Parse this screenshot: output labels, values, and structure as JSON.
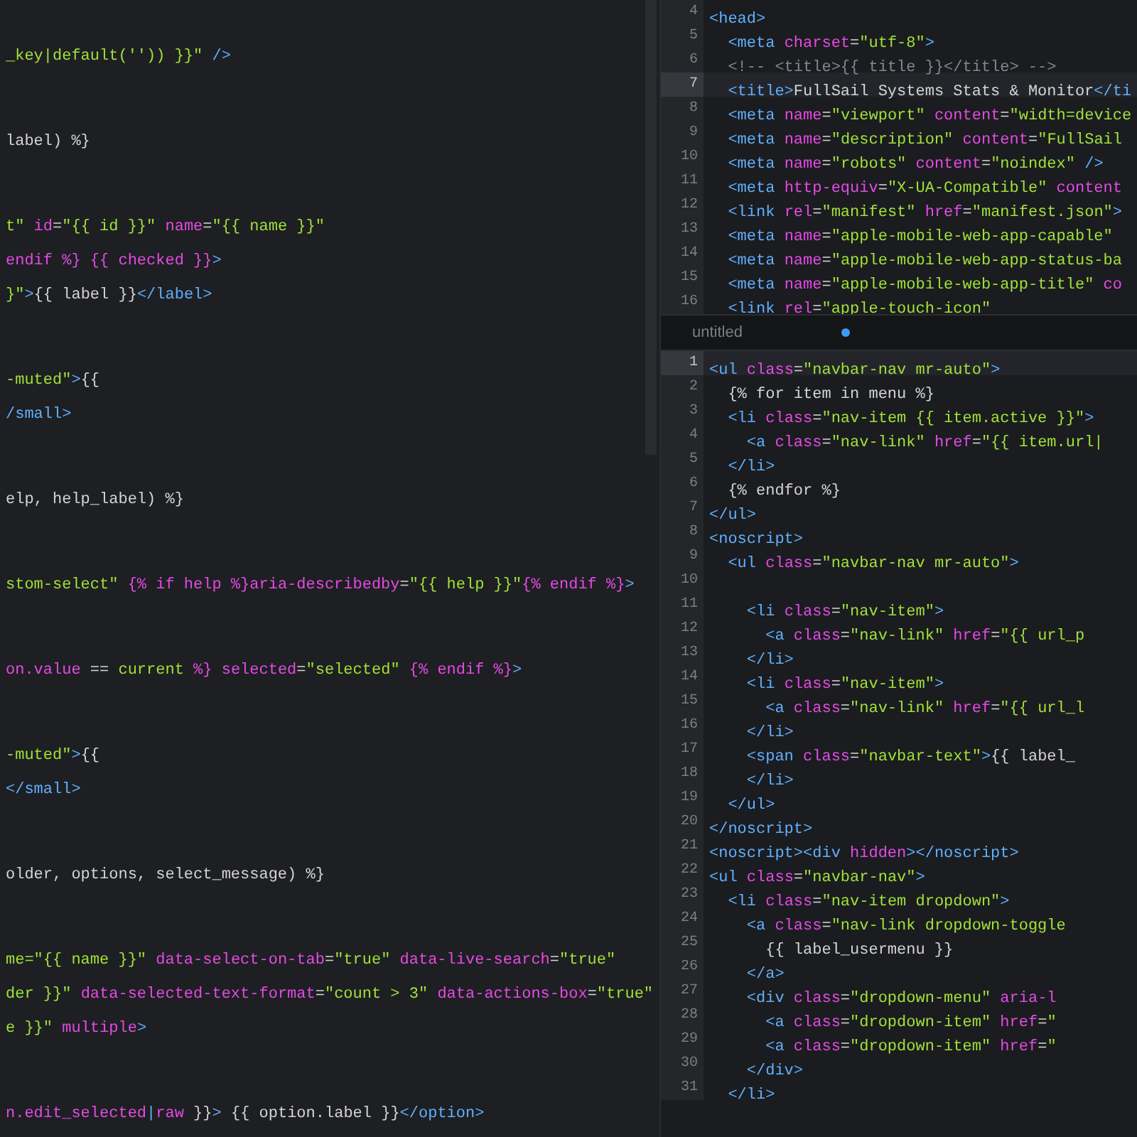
{
  "left_editor": {
    "blocks": [
      [
        {
          "tokens": [
            {
              "kind": "str",
              "text": "_key|default('')) }}\""
            },
            {
              "kind": "tag",
              "text": " />"
            }
          ]
        }
      ],
      [
        {
          "tokens": [
            {
              "kind": "txt",
              "text": "label) %}"
            }
          ]
        }
      ],
      [
        {
          "tokens": [
            {
              "kind": "str",
              "text": "t\""
            },
            {
              "kind": "attr",
              "text": " id"
            },
            {
              "kind": "txt",
              "text": "="
            },
            {
              "kind": "str",
              "text": "\"{{ id }}\""
            },
            {
              "kind": "attr",
              "text": " name"
            },
            {
              "kind": "txt",
              "text": "="
            },
            {
              "kind": "str",
              "text": "\"{{ name }}\""
            }
          ]
        },
        {
          "tokens": [
            {
              "kind": "tpl",
              "text": "endif %} {{ checked }}"
            },
            {
              "kind": "tag",
              "text": ">"
            }
          ]
        },
        {
          "tokens": [
            {
              "kind": "str",
              "text": "}\""
            },
            {
              "kind": "tag",
              "text": ">"
            },
            {
              "kind": "txt",
              "text": "{{ label }}"
            },
            {
              "kind": "tag",
              "text": "</label>"
            }
          ]
        }
      ],
      [
        {
          "tokens": [
            {
              "kind": "str",
              "text": "-muted\""
            },
            {
              "kind": "tag",
              "text": ">"
            },
            {
              "kind": "txt",
              "text": "{{"
            }
          ]
        },
        {
          "tokens": [
            {
              "kind": "tag",
              "text": "/small>"
            }
          ]
        }
      ],
      [
        {
          "tokens": [
            {
              "kind": "txt",
              "text": "elp, help_label) %}"
            }
          ]
        }
      ],
      [
        {
          "tokens": [
            {
              "kind": "str",
              "text": "stom-select\""
            },
            {
              "kind": "tpl",
              "text": " {% if help %}"
            },
            {
              "kind": "attr",
              "text": "aria-describedby"
            },
            {
              "kind": "txt",
              "text": "="
            },
            {
              "kind": "str",
              "text": "\"{{ help }}\""
            },
            {
              "kind": "tpl",
              "text": "{% endif %}"
            },
            {
              "kind": "tag",
              "text": ">"
            }
          ]
        }
      ],
      [
        {
          "tokens": [
            {
              "kind": "attr",
              "text": "on.value"
            },
            {
              "kind": "txt",
              "text": " == "
            },
            {
              "kind": "str",
              "text": "current"
            },
            {
              "kind": "tpl",
              "text": " %}"
            },
            {
              "kind": "attr",
              "text": " selected"
            },
            {
              "kind": "txt",
              "text": "="
            },
            {
              "kind": "str",
              "text": "\"selected\""
            },
            {
              "kind": "tpl",
              "text": " {% endif %}"
            },
            {
              "kind": "tag",
              "text": ">"
            }
          ]
        }
      ],
      [
        {
          "tokens": [
            {
              "kind": "str",
              "text": "-muted\""
            },
            {
              "kind": "tag",
              "text": ">"
            },
            {
              "kind": "txt",
              "text": "{{"
            }
          ]
        },
        {
          "tokens": [
            {
              "kind": "tag",
              "text": "</small>"
            }
          ]
        }
      ],
      [
        {
          "tokens": [
            {
              "kind": "txt",
              "text": "older, options, select_message) %}"
            }
          ]
        }
      ],
      [
        {
          "tokens": [
            {
              "kind": "str",
              "text": "me=\"{{ name }}\""
            },
            {
              "kind": "attr",
              "text": " data-select-on-tab"
            },
            {
              "kind": "txt",
              "text": "="
            },
            {
              "kind": "str",
              "text": "\"true\""
            },
            {
              "kind": "attr",
              "text": " data-live-search"
            },
            {
              "kind": "txt",
              "text": "="
            },
            {
              "kind": "str",
              "text": "\"true\""
            }
          ]
        },
        {
          "tokens": [
            {
              "kind": "str",
              "text": "der }}\""
            },
            {
              "kind": "attr",
              "text": " data-selected-text-format"
            },
            {
              "kind": "txt",
              "text": "="
            },
            {
              "kind": "str",
              "text": "\"count > 3\""
            },
            {
              "kind": "attr",
              "text": " data-actions-box"
            },
            {
              "kind": "txt",
              "text": "="
            },
            {
              "kind": "str",
              "text": "\"true\""
            }
          ]
        },
        {
          "tokens": [
            {
              "kind": "str",
              "text": "e }}\""
            },
            {
              "kind": "attr",
              "text": " multiple"
            },
            {
              "kind": "tag",
              "text": ">"
            }
          ]
        }
      ],
      [
        {
          "tokens": [
            {
              "kind": "attr",
              "text": "n.edit_selected"
            },
            {
              "kind": "tag",
              "text": "|"
            },
            {
              "kind": "attr",
              "text": "raw"
            },
            {
              "kind": "txt",
              "text": " }}"
            },
            {
              "kind": "tag",
              "text": ">"
            },
            {
              "kind": "txt",
              "text": " {{ option.label }}"
            },
            {
              "kind": "tag",
              "text": "</option>"
            }
          ]
        }
      ]
    ]
  },
  "top_editor": {
    "lines": [
      {
        "number": "4",
        "current": false,
        "tokens": [
          {
            "kind": "tag",
            "text": "<head>"
          }
        ]
      },
      {
        "number": "5",
        "current": false,
        "tokens": [
          {
            "kind": "tag",
            "text": "  <meta"
          },
          {
            "kind": "attr",
            "text": " charset"
          },
          {
            "kind": "txt",
            "text": "="
          },
          {
            "kind": "str",
            "text": "\"utf-8\""
          },
          {
            "kind": "tag",
            "text": ">"
          }
        ]
      },
      {
        "number": "6",
        "current": false,
        "tokens": [
          {
            "kind": "cmt",
            "text": "  <!-- <title>{{ title }}</title> -->"
          }
        ]
      },
      {
        "number": "7",
        "current": true,
        "tokens": [
          {
            "kind": "tag",
            "text": "  <title>"
          },
          {
            "kind": "txt",
            "text": "FullSail Systems Stats & Monitor"
          },
          {
            "kind": "tag",
            "text": "</ti"
          }
        ]
      },
      {
        "number": "8",
        "current": false,
        "tokens": [
          {
            "kind": "tag",
            "text": "  <meta"
          },
          {
            "kind": "attr",
            "text": " name"
          },
          {
            "kind": "txt",
            "text": "="
          },
          {
            "kind": "str",
            "text": "\"viewport\""
          },
          {
            "kind": "attr",
            "text": " content"
          },
          {
            "kind": "txt",
            "text": "="
          },
          {
            "kind": "str",
            "text": "\"width=device"
          }
        ]
      },
      {
        "number": "9",
        "current": false,
        "tokens": [
          {
            "kind": "tag",
            "text": "  <meta"
          },
          {
            "kind": "attr",
            "text": " name"
          },
          {
            "kind": "txt",
            "text": "="
          },
          {
            "kind": "str",
            "text": "\"description\""
          },
          {
            "kind": "attr",
            "text": " content"
          },
          {
            "kind": "txt",
            "text": "="
          },
          {
            "kind": "str",
            "text": "\"FullSail"
          }
        ]
      },
      {
        "number": "10",
        "current": false,
        "tokens": [
          {
            "kind": "tag",
            "text": "  <meta"
          },
          {
            "kind": "attr",
            "text": " name"
          },
          {
            "kind": "txt",
            "text": "="
          },
          {
            "kind": "str",
            "text": "\"robots\""
          },
          {
            "kind": "attr",
            "text": " content"
          },
          {
            "kind": "txt",
            "text": "="
          },
          {
            "kind": "str",
            "text": "\"noindex\""
          },
          {
            "kind": "tag",
            "text": " />"
          }
        ]
      },
      {
        "number": "11",
        "current": false,
        "tokens": [
          {
            "kind": "tag",
            "text": "  <meta"
          },
          {
            "kind": "attr",
            "text": " http-equiv"
          },
          {
            "kind": "txt",
            "text": "="
          },
          {
            "kind": "str",
            "text": "\"X-UA-Compatible\""
          },
          {
            "kind": "attr",
            "text": " content"
          }
        ]
      },
      {
        "number": "12",
        "current": false,
        "tokens": [
          {
            "kind": "tag",
            "text": "  <link"
          },
          {
            "kind": "attr",
            "text": " rel"
          },
          {
            "kind": "txt",
            "text": "="
          },
          {
            "kind": "str",
            "text": "\"manifest\""
          },
          {
            "kind": "attr",
            "text": " href"
          },
          {
            "kind": "txt",
            "text": "="
          },
          {
            "kind": "str",
            "text": "\"manifest.json\""
          },
          {
            "kind": "tag",
            "text": ">"
          }
        ]
      },
      {
        "number": "13",
        "current": false,
        "tokens": [
          {
            "kind": "tag",
            "text": "  <meta"
          },
          {
            "kind": "attr",
            "text": " name"
          },
          {
            "kind": "txt",
            "text": "="
          },
          {
            "kind": "str",
            "text": "\"apple-mobile-web-app-capable\""
          }
        ]
      },
      {
        "number": "14",
        "current": false,
        "tokens": [
          {
            "kind": "tag",
            "text": "  <meta"
          },
          {
            "kind": "attr",
            "text": " name"
          },
          {
            "kind": "txt",
            "text": "="
          },
          {
            "kind": "str",
            "text": "\"apple-mobile-web-app-status-ba"
          }
        ]
      },
      {
        "number": "15",
        "current": false,
        "tokens": [
          {
            "kind": "tag",
            "text": "  <meta"
          },
          {
            "kind": "attr",
            "text": " name"
          },
          {
            "kind": "txt",
            "text": "="
          },
          {
            "kind": "str",
            "text": "\"apple-mobile-web-app-title\""
          },
          {
            "kind": "attr",
            "text": " co"
          }
        ]
      },
      {
        "number": "16",
        "current": false,
        "tokens": [
          {
            "kind": "tag",
            "text": "  <link"
          },
          {
            "kind": "attr",
            "text": " rel"
          },
          {
            "kind": "txt",
            "text": "="
          },
          {
            "kind": "str",
            "text": "\"apple-touch-icon\""
          }
        ]
      }
    ]
  },
  "tab": {
    "label": "untitled",
    "modified": true
  },
  "bottom_editor": {
    "lines": [
      {
        "number": "1",
        "current": true,
        "tokens": [
          {
            "kind": "tag",
            "text": "<ul"
          },
          {
            "kind": "attr",
            "text": " class"
          },
          {
            "kind": "txt",
            "text": "="
          },
          {
            "kind": "str",
            "text": "\"navbar-nav mr-auto\""
          },
          {
            "kind": "tag",
            "text": ">"
          }
        ]
      },
      {
        "number": "2",
        "current": false,
        "tokens": [
          {
            "kind": "txt",
            "text": "  {% for item in menu %}"
          }
        ]
      },
      {
        "number": "3",
        "current": false,
        "tokens": [
          {
            "kind": "tag",
            "text": "  <li"
          },
          {
            "kind": "attr",
            "text": " class"
          },
          {
            "kind": "txt",
            "text": "="
          },
          {
            "kind": "str",
            "text": "\"nav-item {{ item.active }}\""
          },
          {
            "kind": "tag",
            "text": ">"
          }
        ]
      },
      {
        "number": "4",
        "current": false,
        "tokens": [
          {
            "kind": "tag",
            "text": "    <a"
          },
          {
            "kind": "attr",
            "text": " class"
          },
          {
            "kind": "txt",
            "text": "="
          },
          {
            "kind": "str",
            "text": "\"nav-link\""
          },
          {
            "kind": "attr",
            "text": " href"
          },
          {
            "kind": "txt",
            "text": "="
          },
          {
            "kind": "str",
            "text": "\"{{ item.url|"
          }
        ]
      },
      {
        "number": "5",
        "current": false,
        "tokens": [
          {
            "kind": "tag",
            "text": "  </li>"
          }
        ]
      },
      {
        "number": "6",
        "current": false,
        "tokens": [
          {
            "kind": "txt",
            "text": "  {% endfor %}"
          }
        ]
      },
      {
        "number": "7",
        "current": false,
        "tokens": [
          {
            "kind": "tag",
            "text": "</ul>"
          }
        ]
      },
      {
        "number": "8",
        "current": false,
        "tokens": [
          {
            "kind": "tag",
            "text": "<noscript>"
          }
        ]
      },
      {
        "number": "9",
        "current": false,
        "tokens": [
          {
            "kind": "tag",
            "text": "  <ul"
          },
          {
            "kind": "attr",
            "text": " class"
          },
          {
            "kind": "txt",
            "text": "="
          },
          {
            "kind": "str",
            "text": "\"navbar-nav mr-auto\""
          },
          {
            "kind": "tag",
            "text": ">"
          }
        ]
      },
      {
        "number": "10",
        "current": false
      },
      {
        "number": "11",
        "current": false,
        "tokens": [
          {
            "kind": "tag",
            "text": "    <li"
          },
          {
            "kind": "attr",
            "text": " class"
          },
          {
            "kind": "txt",
            "text": "="
          },
          {
            "kind": "str",
            "text": "\"nav-item\""
          },
          {
            "kind": "tag",
            "text": ">"
          }
        ]
      },
      {
        "number": "12",
        "current": false,
        "tokens": [
          {
            "kind": "tag",
            "text": "      <a"
          },
          {
            "kind": "attr",
            "text": " class"
          },
          {
            "kind": "txt",
            "text": "="
          },
          {
            "kind": "str",
            "text": "\"nav-link\""
          },
          {
            "kind": "attr",
            "text": " href"
          },
          {
            "kind": "txt",
            "text": "="
          },
          {
            "kind": "str",
            "text": "\"{{ url_p"
          }
        ]
      },
      {
        "number": "13",
        "current": false,
        "tokens": [
          {
            "kind": "tag",
            "text": "    </li>"
          }
        ]
      },
      {
        "number": "14",
        "current": false,
        "tokens": [
          {
            "kind": "tag",
            "text": "    <li"
          },
          {
            "kind": "attr",
            "text": " class"
          },
          {
            "kind": "txt",
            "text": "="
          },
          {
            "kind": "str",
            "text": "\"nav-item\""
          },
          {
            "kind": "tag",
            "text": ">"
          }
        ]
      },
      {
        "number": "15",
        "current": false,
        "tokens": [
          {
            "kind": "tag",
            "text": "      <a"
          },
          {
            "kind": "attr",
            "text": " class"
          },
          {
            "kind": "txt",
            "text": "="
          },
          {
            "kind": "str",
            "text": "\"nav-link\""
          },
          {
            "kind": "attr",
            "text": " href"
          },
          {
            "kind": "txt",
            "text": "="
          },
          {
            "kind": "str",
            "text": "\"{{ url_l"
          }
        ]
      },
      {
        "number": "16",
        "current": false,
        "tokens": [
          {
            "kind": "tag",
            "text": "    </li>"
          }
        ]
      },
      {
        "number": "17",
        "current": false,
        "tokens": [
          {
            "kind": "tag",
            "text": "    <span"
          },
          {
            "kind": "attr",
            "text": " class"
          },
          {
            "kind": "txt",
            "text": "="
          },
          {
            "kind": "str",
            "text": "\"navbar-text\""
          },
          {
            "kind": "tag",
            "text": ">"
          },
          {
            "kind": "txt",
            "text": "{{ label_"
          }
        ]
      },
      {
        "number": "18",
        "current": false,
        "tokens": [
          {
            "kind": "tag",
            "text": "    </li>"
          }
        ]
      },
      {
        "number": "19",
        "current": false,
        "tokens": [
          {
            "kind": "tag",
            "text": "  </ul>"
          }
        ]
      },
      {
        "number": "20",
        "current": false,
        "tokens": [
          {
            "kind": "tag",
            "text": "</noscript>"
          }
        ]
      },
      {
        "number": "21",
        "current": false,
        "tokens": [
          {
            "kind": "tag",
            "text": "<noscript><div"
          },
          {
            "kind": "attr",
            "text": " hidden"
          },
          {
            "kind": "tag",
            "text": "></noscript>"
          }
        ]
      },
      {
        "number": "22",
        "current": false,
        "tokens": [
          {
            "kind": "tag",
            "text": "<ul"
          },
          {
            "kind": "attr",
            "text": " class"
          },
          {
            "kind": "txt",
            "text": "="
          },
          {
            "kind": "str",
            "text": "\"navbar-nav\""
          },
          {
            "kind": "tag",
            "text": ">"
          }
        ]
      },
      {
        "number": "23",
        "current": false,
        "tokens": [
          {
            "kind": "tag",
            "text": "  <li"
          },
          {
            "kind": "attr",
            "text": " class"
          },
          {
            "kind": "txt",
            "text": "="
          },
          {
            "kind": "str",
            "text": "\"nav-item dropdown\""
          },
          {
            "kind": "tag",
            "text": ">"
          }
        ]
      },
      {
        "number": "24",
        "current": false,
        "tokens": [
          {
            "kind": "tag",
            "text": "    <a"
          },
          {
            "kind": "attr",
            "text": " class"
          },
          {
            "kind": "txt",
            "text": "="
          },
          {
            "kind": "str",
            "text": "\"nav-link dropdown-toggle"
          }
        ]
      },
      {
        "number": "25",
        "current": false,
        "tokens": [
          {
            "kind": "txt",
            "text": "      {{ label_usermenu }}"
          }
        ]
      },
      {
        "number": "26",
        "current": false,
        "tokens": [
          {
            "kind": "tag",
            "text": "    </a>"
          }
        ]
      },
      {
        "number": "27",
        "current": false,
        "tokens": [
          {
            "kind": "tag",
            "text": "    <div"
          },
          {
            "kind": "attr",
            "text": " class"
          },
          {
            "kind": "txt",
            "text": "="
          },
          {
            "kind": "str",
            "text": "\"dropdown-menu\""
          },
          {
            "kind": "attr",
            "text": " aria-l"
          }
        ]
      },
      {
        "number": "28",
        "current": false,
        "tokens": [
          {
            "kind": "tag",
            "text": "      <a"
          },
          {
            "kind": "attr",
            "text": " class"
          },
          {
            "kind": "txt",
            "text": "="
          },
          {
            "kind": "str",
            "text": "\"dropdown-item\""
          },
          {
            "kind": "attr",
            "text": " href"
          },
          {
            "kind": "txt",
            "text": "="
          },
          {
            "kind": "str",
            "text": "\""
          }
        ]
      },
      {
        "number": "29",
        "current": false,
        "tokens": [
          {
            "kind": "tag",
            "text": "      <a"
          },
          {
            "kind": "attr",
            "text": " class"
          },
          {
            "kind": "txt",
            "text": "="
          },
          {
            "kind": "str",
            "text": "\"dropdown-item\""
          },
          {
            "kind": "attr",
            "text": " href"
          },
          {
            "kind": "txt",
            "text": "="
          },
          {
            "kind": "str",
            "text": "\""
          }
        ]
      },
      {
        "number": "30",
        "current": false,
        "tokens": [
          {
            "kind": "tag",
            "text": "    </div>"
          }
        ]
      },
      {
        "number": "31",
        "current": false,
        "tokens": [
          {
            "kind": "tag",
            "text": "  </li>"
          }
        ]
      }
    ]
  }
}
